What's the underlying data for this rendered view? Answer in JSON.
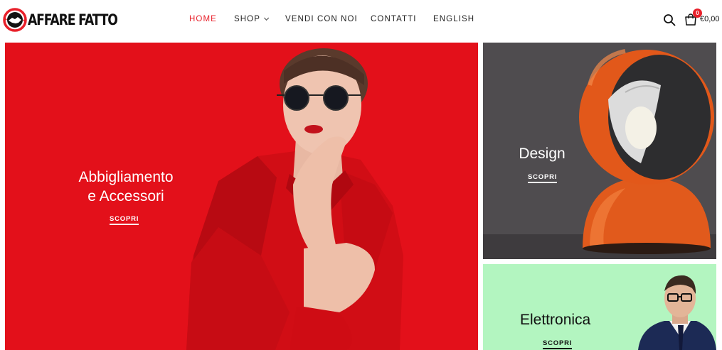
{
  "brand": {
    "name": "AFFARE FATTO"
  },
  "nav": {
    "items": [
      {
        "label": "HOME",
        "active": true
      },
      {
        "label": "SHOP",
        "has_dropdown": true
      },
      {
        "label": "VENDI CON NOI"
      },
      {
        "label": "CONTATTI"
      },
      {
        "label": "ENGLISH"
      }
    ]
  },
  "header_actions": {
    "search_icon": "search-icon",
    "cart_icon": "shopping-bag-icon",
    "cart_count": "0",
    "cart_total": "€0,00"
  },
  "banners": {
    "main": {
      "title_line1": "Abbigliamento",
      "title_line2": "e Accessori",
      "cta": "SCOPRI",
      "bg_color": "#e3101a"
    },
    "design": {
      "title": "Design",
      "cta": "SCOPRI",
      "bg_color": "#4f4c4f"
    },
    "electronics": {
      "title": "Elettronica",
      "cta": "SCOPRI",
      "bg_color": "#b3f5c0"
    }
  },
  "colors": {
    "accent": "#e8202a",
    "text": "#111111"
  }
}
